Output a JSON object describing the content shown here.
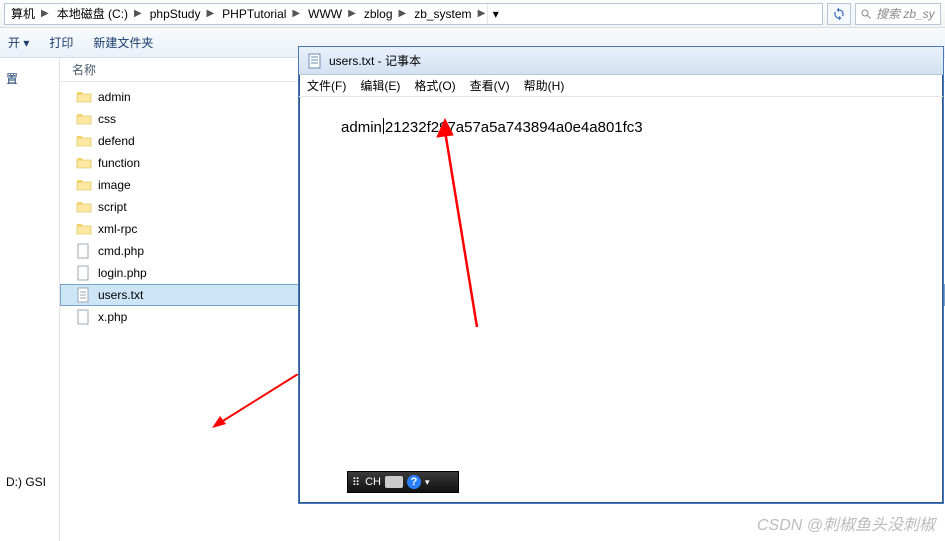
{
  "breadcrumb": [
    "算机",
    "本地磁盘 (C:)",
    "phpStudy",
    "PHPTutorial",
    "WWW",
    "zblog",
    "zb_system"
  ],
  "search_placeholder": "搜索 zb_sy",
  "toolbar": {
    "open": "开 ▾",
    "print": "打印",
    "newfolder": "新建文件夹"
  },
  "left": {
    "head": "置",
    "drive": "D:) GSI"
  },
  "columns": {
    "name": "名称"
  },
  "files": [
    {
      "type": "folder",
      "name": "admin"
    },
    {
      "type": "folder",
      "name": "css"
    },
    {
      "type": "folder",
      "name": "defend"
    },
    {
      "type": "folder",
      "name": "function"
    },
    {
      "type": "folder",
      "name": "image"
    },
    {
      "type": "folder",
      "name": "script"
    },
    {
      "type": "folder",
      "name": "xml-rpc"
    },
    {
      "type": "php",
      "name": "cmd.php"
    },
    {
      "type": "php",
      "name": "login.php"
    },
    {
      "type": "txt",
      "name": "users.txt",
      "selected": true
    },
    {
      "type": "php",
      "name": "x.php"
    }
  ],
  "notepad": {
    "title": "users.txt - 记事本",
    "menu": [
      "文件(F)",
      "编辑(E)",
      "格式(O)",
      "查看(V)",
      "帮助(H)"
    ],
    "content_left": "admin",
    "content_right": "21232f297a57a5a743894a0e4a801fc3"
  },
  "ime": {
    "label": "CH",
    "help": "?"
  },
  "watermark": "CSDN @刺椒鱼头没刺椒"
}
